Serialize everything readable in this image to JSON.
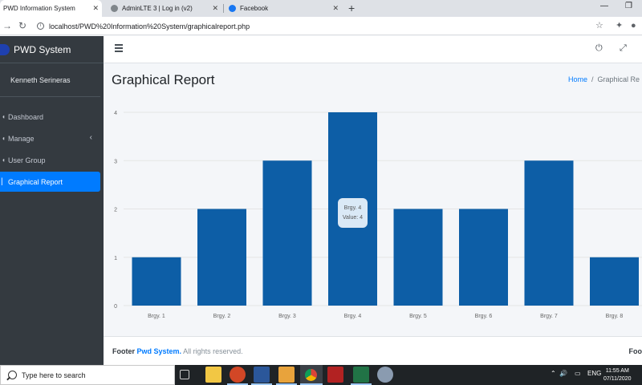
{
  "browser": {
    "tabs": [
      {
        "title": "PWD Information System",
        "active": true
      },
      {
        "title": "AdminLTE 3 | Log in (v2)",
        "active": false
      },
      {
        "title": "Facebook",
        "active": false
      }
    ],
    "url": "localhost/PWD%20Information%20System/graphicalreport.php"
  },
  "sidebar": {
    "brand": "PWD System",
    "user": "Kenneth Serineras",
    "items": [
      {
        "label": "Dashboard",
        "icon": "dashboard-icon"
      },
      {
        "label": "Manage",
        "icon": "edit-icon"
      },
      {
        "label": "User Group",
        "icon": "users-icon"
      },
      {
        "label": "Graphical Report",
        "icon": "chart-icon"
      }
    ]
  },
  "header": {
    "title": "Graphical Report",
    "breadcrumb_home": "Home",
    "breadcrumb_current": "Graphical Re"
  },
  "chart_data": {
    "type": "bar",
    "categories": [
      "Brgy. 1",
      "Brgy. 2",
      "Brgy. 3",
      "Brgy. 4",
      "Brgy. 5",
      "Brgy. 6",
      "Brgy. 7",
      "Brgy. 8"
    ],
    "values": [
      1,
      2,
      3,
      4,
      2,
      2,
      3,
      1
    ],
    "ylim": [
      0,
      4
    ],
    "yticks": [
      "0",
      "1",
      "2",
      "3",
      "4"
    ],
    "bar_color": "#0d5ea6",
    "grid": true,
    "tooltip": {
      "label": "Brgy. 4",
      "value_text": "Value: 4"
    }
  },
  "footer": {
    "prefix": "Footer",
    "brand": "Pwd System.",
    "suffix": "All rights reserved.",
    "right": "Foo"
  },
  "taskbar": {
    "search_placeholder": "Type here to search",
    "language": "ENG",
    "time": "11:55 AM",
    "date": "07/11/2020"
  },
  "colors": {
    "accent": "#007bff",
    "sidebar_bg": "#343a40",
    "bar": "#0d5ea6"
  }
}
